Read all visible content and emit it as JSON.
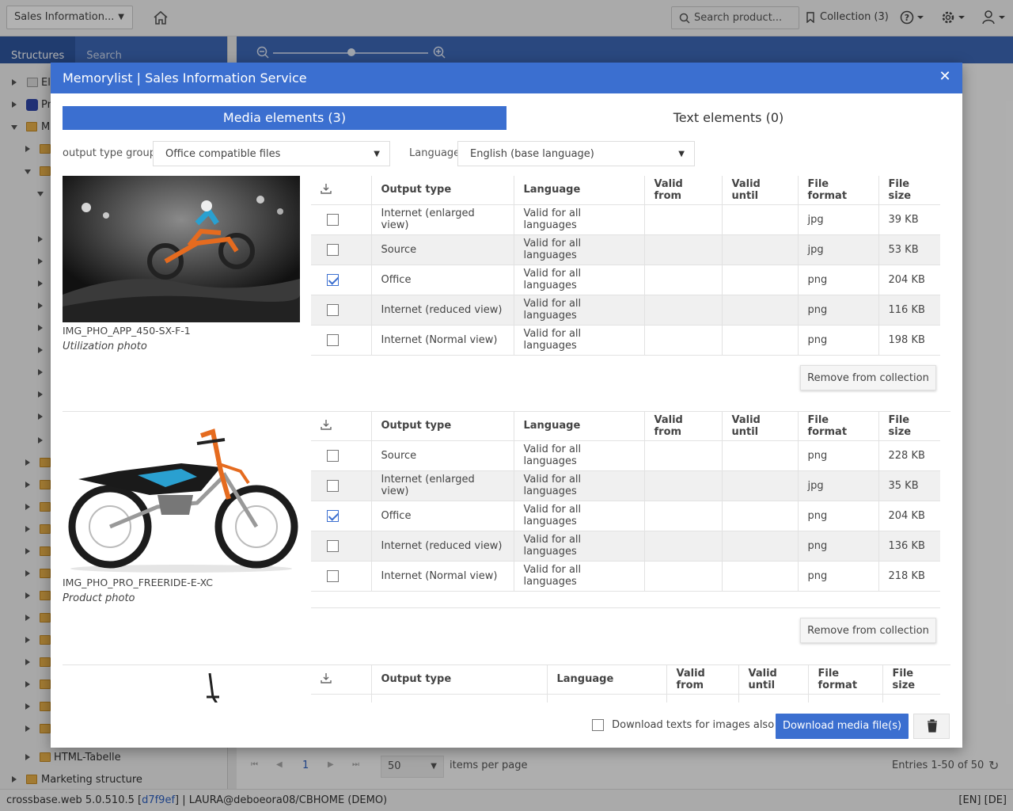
{
  "app": {
    "selector_value": "Sales Information...",
    "search_placeholder": "Search product...",
    "collection_label": "Collection (3)"
  },
  "left_panel": {
    "tabs": [
      "Structures",
      "Search"
    ],
    "tree_labels": {
      "r1": "El",
      "r2": "Pr",
      "r3": "M",
      "html_table": "HTML-Tabelle",
      "marketing": "Marketing structure"
    }
  },
  "pager": {
    "page": "1",
    "per_page_value": "50",
    "per_page_label": "items per page",
    "entries": "Entries 1-50 of 50"
  },
  "status_bar": {
    "version_prefix": "crossbase.web 5.0.510.5 [",
    "hash": "d7f9ef",
    "version_suffix": "] | LAURA@deboeora08/CBHOME (DEMO)",
    "languages": "[EN] [DE]"
  },
  "modal": {
    "title": "Memorylist | Sales Information Service",
    "tabs": {
      "media": "Media elements (3)",
      "text": "Text elements (0)"
    },
    "filters": {
      "output_type_group_label": "output type group",
      "output_type_group_value": "Office compatible files",
      "language_label": "Language",
      "language_value": "English (base language)"
    },
    "table_headers": {
      "output_type": "Output type",
      "language": "Language",
      "valid_from": "Valid from",
      "valid_until": "Valid until",
      "file_format": "File format",
      "file_size": "File size"
    },
    "remove_label": "Remove from collection",
    "items": [
      {
        "id": "IMG_PHO_APP_450-SX-F-1",
        "type": "Utilization photo",
        "rows": [
          {
            "output_type": "Internet (enlarged view)",
            "language": "Valid for all languages",
            "valid_from": "",
            "valid_until": "",
            "format": "jpg",
            "size": "39 KB",
            "checked": false
          },
          {
            "output_type": "Source",
            "language": "Valid for all languages",
            "valid_from": "",
            "valid_until": "",
            "format": "jpg",
            "size": "53 KB",
            "checked": false
          },
          {
            "output_type": "Office",
            "language": "Valid for all languages",
            "valid_from": "",
            "valid_until": "",
            "format": "png",
            "size": "204 KB",
            "checked": true
          },
          {
            "output_type": "Internet (reduced view)",
            "language": "Valid for all languages",
            "valid_from": "",
            "valid_until": "",
            "format": "png",
            "size": "116 KB",
            "checked": false
          },
          {
            "output_type": "Internet (Normal view)",
            "language": "Valid for all languages",
            "valid_from": "",
            "valid_until": "",
            "format": "png",
            "size": "198 KB",
            "checked": false
          }
        ]
      },
      {
        "id": "IMG_PHO_PRO_FREERIDE-E-XC",
        "type": "Product photo",
        "rows": [
          {
            "output_type": "Source",
            "language": "Valid for all languages",
            "valid_from": "",
            "valid_until": "",
            "format": "png",
            "size": "228 KB",
            "checked": false
          },
          {
            "output_type": "Internet (enlarged view)",
            "language": "Valid for all languages",
            "valid_from": "",
            "valid_until": "",
            "format": "jpg",
            "size": "35 KB",
            "checked": false
          },
          {
            "output_type": "Office",
            "language": "Valid for all languages",
            "valid_from": "",
            "valid_until": "",
            "format": "png",
            "size": "204 KB",
            "checked": true
          },
          {
            "output_type": "Internet (reduced view)",
            "language": "Valid for all languages",
            "valid_from": "",
            "valid_until": "",
            "format": "png",
            "size": "136 KB",
            "checked": false
          },
          {
            "output_type": "Internet (Normal view)",
            "language": "Valid for all languages",
            "valid_from": "",
            "valid_until": "",
            "format": "png",
            "size": "218 KB",
            "checked": false
          }
        ]
      }
    ],
    "footer": {
      "download_texts_label": "Download texts for images also",
      "download_button": "Download media file(s)"
    }
  },
  "colors": {
    "accent": "#3b6fd0",
    "header_blue": "#3d67b6"
  }
}
